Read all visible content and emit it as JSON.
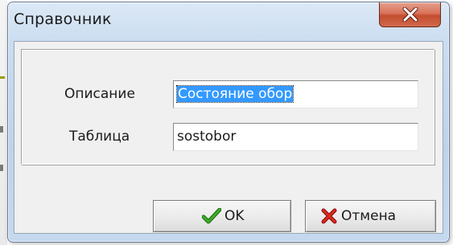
{
  "window": {
    "title": "Справочник",
    "close_icon": "close-icon"
  },
  "form": {
    "description_label": "Описание",
    "description_value": "Состояние обор",
    "table_label": "Таблица",
    "table_value": "sostobor"
  },
  "buttons": {
    "ok_label": "OK",
    "ok_icon": "check-icon",
    "cancel_label": "Отмена",
    "cancel_icon": "cross-icon"
  },
  "colors": {
    "selection": "#3399ff",
    "check_green": "#2e8b1e",
    "cross_red": "#c81e1e",
    "close_red": "#c44d2f"
  }
}
